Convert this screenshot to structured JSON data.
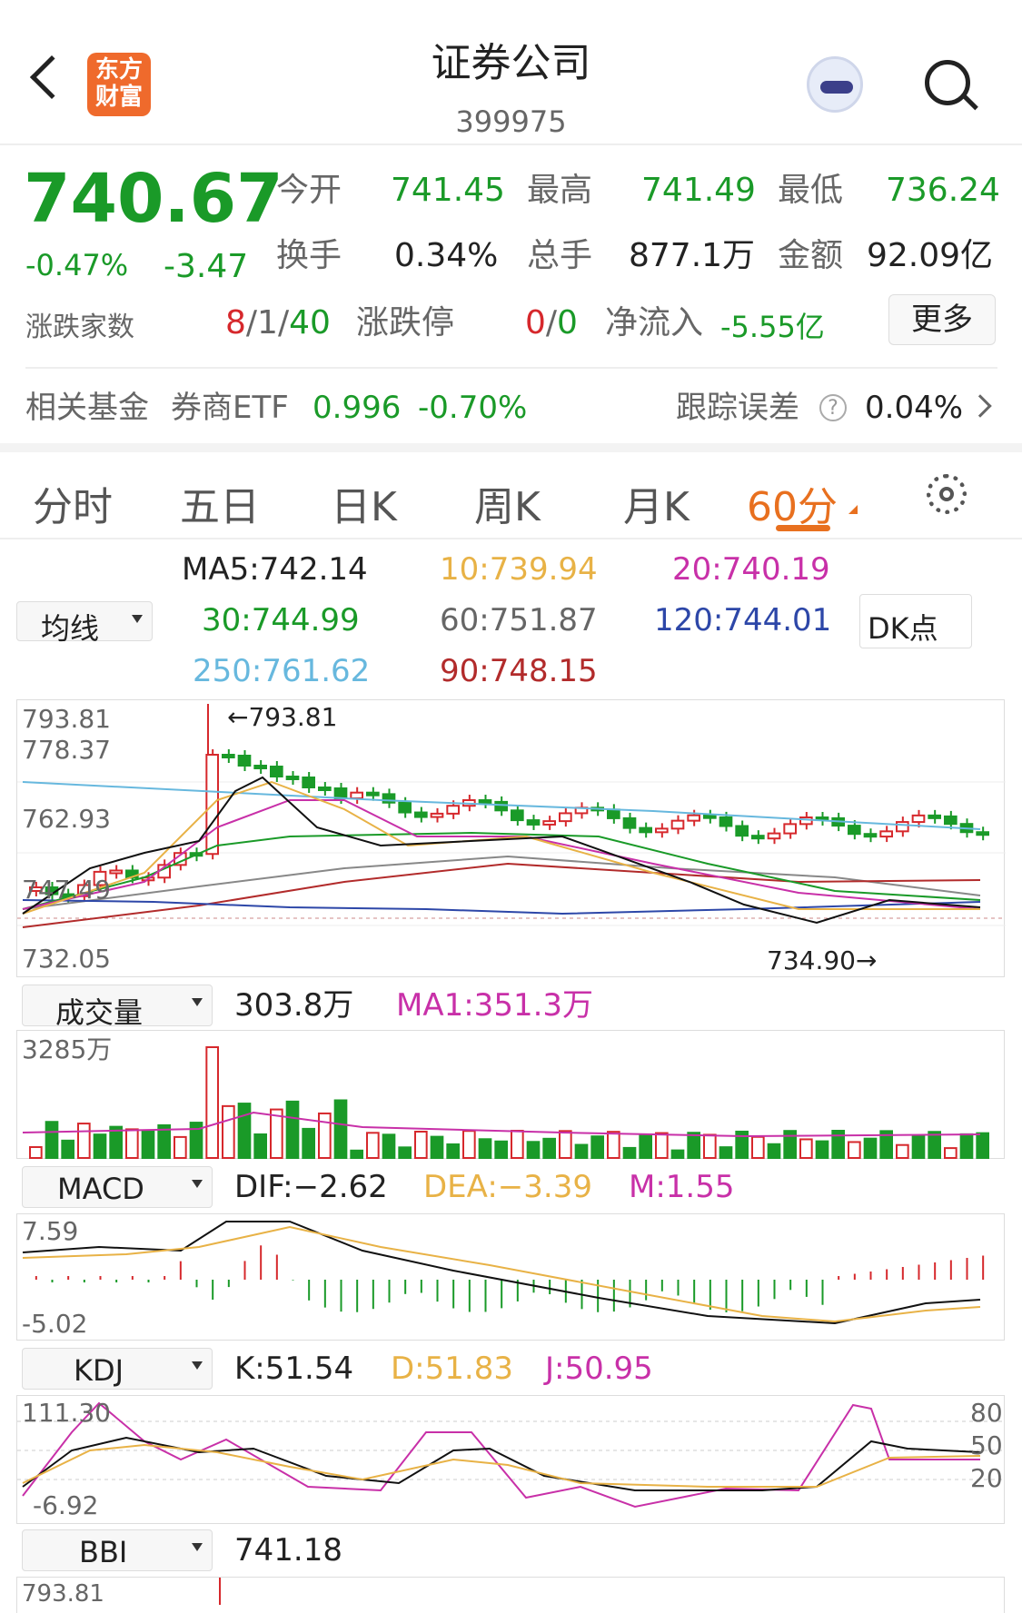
{
  "header": {
    "title": "证券公司",
    "code": "399975",
    "logo_line1": "东方",
    "logo_line2": "财富"
  },
  "quote": {
    "price": "740.67",
    "change_pct": "-0.47%",
    "change": "-3.47",
    "open_label": "今开",
    "open": "741.45",
    "high_label": "最高",
    "high": "741.49",
    "low_label": "最低",
    "low": "736.24",
    "turnover_label": "换手",
    "turnover": "0.34%",
    "volume_label": "总手",
    "volume": "877.1万",
    "amount_label": "金额",
    "amount": "92.09亿",
    "updown_label": "涨跌家数",
    "up": "8",
    "flat": "1",
    "down": "40",
    "limit_label": "涨跌停",
    "limit_up": "0",
    "limit_down": "0",
    "inflow_label": "净流入",
    "inflow": "-5.55亿",
    "more": "更多"
  },
  "fund": {
    "label": "相关基金",
    "name": "券商ETF",
    "price": "0.996",
    "pct": "-0.70%",
    "track_label": "跟踪误差",
    "track": "0.04%"
  },
  "tabs": [
    "分时",
    "五日",
    "日K",
    "周K",
    "月K",
    "60分"
  ],
  "ma": {
    "select": "均线",
    "ma5": "MA5:742.14",
    "ma10": "10:739.94",
    "ma20": "20:740.19",
    "ma30": "30:744.99",
    "ma60": "60:751.87",
    "ma120": "120:744.01",
    "ma250": "250:761.62",
    "ma90": "90:748.15",
    "dk": "DK点"
  },
  "kline": {
    "y1": "793.81",
    "y2": "778.37",
    "y3": "762.93",
    "y4": "747.49",
    "y5": "732.05",
    "max_label": "←793.81",
    "min_label": "734.90→"
  },
  "volume": {
    "select": "成交量",
    "value": "303.8万",
    "ma1": "MA1:351.3万",
    "ymax": "3285万"
  },
  "macd": {
    "select": "MACD",
    "dif": "DIF:−2.62",
    "dea": "DEA:−3.39",
    "m": "M:1.55",
    "ymax": "7.59",
    "ymin": "-5.02"
  },
  "kdj": {
    "select": "KDJ",
    "k": "K:51.54",
    "d": "D:51.83",
    "j": "J:50.95",
    "ymax": "111.30",
    "ymin": "-6.92",
    "r80": "80",
    "r50": "50",
    "r20": "20"
  },
  "bbi": {
    "select": "BBI",
    "value": "741.18",
    "ymax": "793.81"
  },
  "colors": {
    "up": "#d6282c",
    "down": "#1a9a28",
    "accent": "#e8701f"
  }
}
